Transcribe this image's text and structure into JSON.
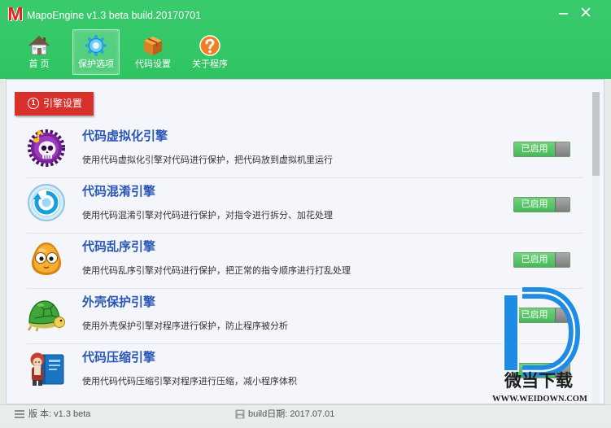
{
  "window": {
    "title": "MapoEngine v1.3 beta build.20170701",
    "logo": "M",
    "controls": [
      "minimize-icon",
      "close-icon"
    ]
  },
  "colors": {
    "header_green": "#2fc462",
    "tab_red": "#d8302b",
    "title_blue": "#2b57b4",
    "toggle_green": "#46b85a"
  },
  "toolbar": {
    "items": [
      {
        "label": "首 页",
        "icon": "home-icon",
        "selected": false
      },
      {
        "label": "保护选项",
        "icon": "gear-icon",
        "selected": true
      },
      {
        "label": "代码设置",
        "icon": "package-icon",
        "selected": false
      },
      {
        "label": "关于程序",
        "icon": "question-icon",
        "selected": false
      }
    ]
  },
  "section": {
    "number": "1",
    "title": "引擎设置"
  },
  "engines": [
    {
      "name": "代码虚拟化引擎",
      "description": "使用代码虚拟化引擎对代码进行保护，把代码放到虚拟机里运行",
      "status": "已启用",
      "enabled": true,
      "icon": "purple-skull-icon"
    },
    {
      "name": "代码混淆引擎",
      "description": "使用代码混淆引擎对代码进行保护，对指令进行拆分、加花处理",
      "status": "已启用",
      "enabled": true,
      "icon": "blue-cycle-icon"
    },
    {
      "name": "代码乱序引擎",
      "description": "使用代码乱序引擎对代码进行保护，把正常的指令顺序进行打乱处理",
      "status": "已启用",
      "enabled": true,
      "icon": "orange-creature-icon"
    },
    {
      "name": "外壳保护引擎",
      "description": "使用外壳保护引擎对程序进行保护，防止程序被分析",
      "status": "已启用",
      "enabled": true,
      "icon": "turtle-shell-icon"
    },
    {
      "name": "代码压缩引擎",
      "description": "使用代码代码压缩引擎对程序进行压缩，减小程序体积",
      "status": "已启用",
      "enabled": true,
      "icon": "book-character-icon"
    }
  ],
  "scroll": {
    "position": 0,
    "visible_fraction": 0.27
  },
  "status_bar": {
    "version": "版 本: v1.3 beta",
    "build": "build日期: 2017.07.01"
  },
  "watermark": {
    "name": "微当下载",
    "site": "WWW.WEIDOWN.COM"
  }
}
